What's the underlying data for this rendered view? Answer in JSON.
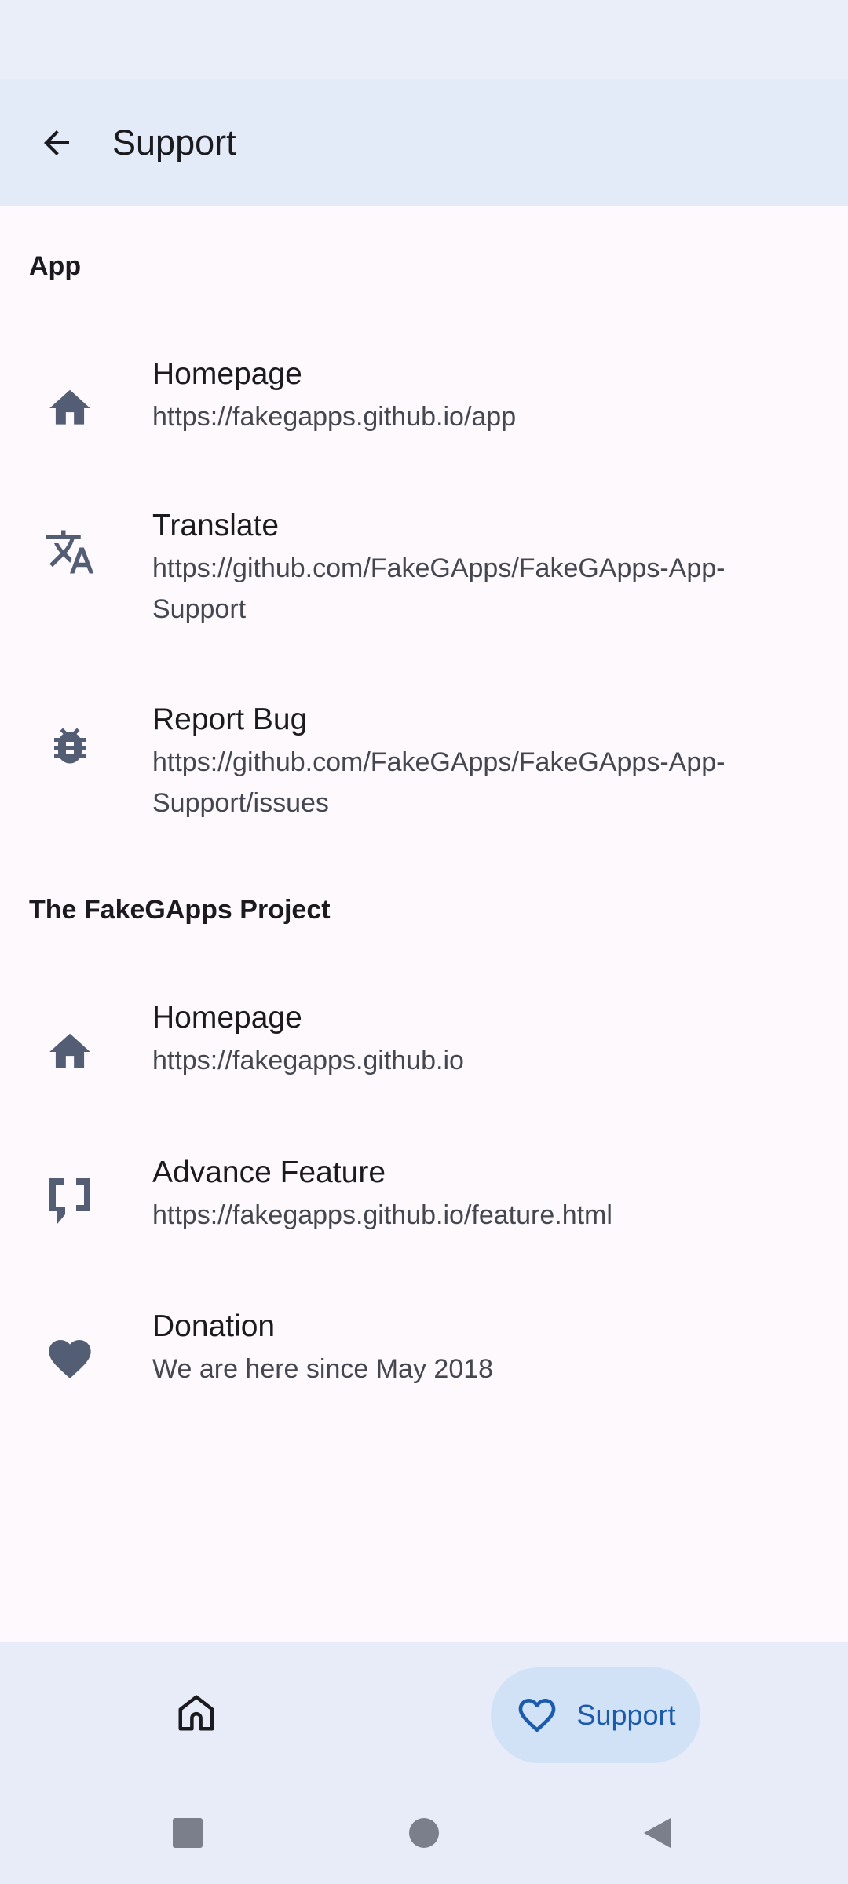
{
  "top_bar": {
    "title": "Support"
  },
  "sections": [
    {
      "header": "App",
      "items": [
        {
          "icon": "home-icon",
          "title": "Homepage",
          "subtitle": "https://fakegapps.github.io/app"
        },
        {
          "icon": "translate-icon",
          "title": "Translate",
          "subtitle": "https://github.com/FakeGApps/FakeGApps-App-Support"
        },
        {
          "icon": "bug-icon",
          "title": "Report Bug",
          "subtitle": "https://github.com/FakeGApps/FakeGApps-App-Support/issues"
        }
      ]
    },
    {
      "header": "The FakeGApps Project",
      "items": [
        {
          "icon": "home-icon",
          "title": "Homepage",
          "subtitle": "https://fakegapps.github.io"
        },
        {
          "icon": "feature-icon",
          "title": "Advance Feature",
          "subtitle": "https://fakegapps.github.io/feature.html"
        },
        {
          "icon": "heart-icon",
          "title": "Donation",
          "subtitle": "We are here since May 2018"
        }
      ]
    }
  ],
  "bottom_nav": {
    "home_icon": "home-outline-icon",
    "support_icon": "heart-outline-icon",
    "support_label": "Support"
  },
  "colors": {
    "accent": "#1c5bab",
    "icon": "#535e75",
    "top_bar": "#e3eaf8",
    "nav_pill": "#d2e2f6"
  }
}
